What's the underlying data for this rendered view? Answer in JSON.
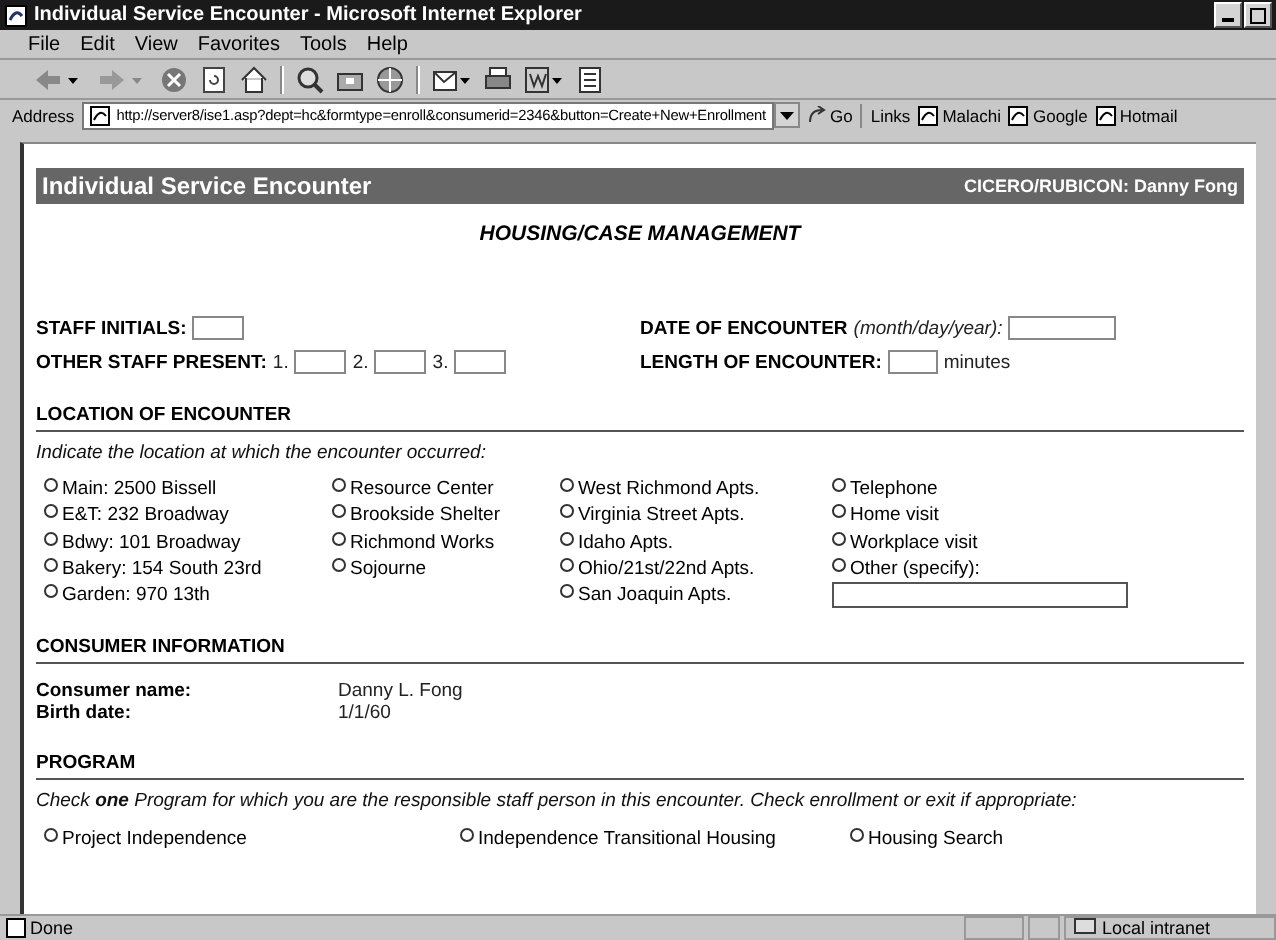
{
  "window": {
    "title": "Individual Service Encounter - Microsoft Internet Explorer"
  },
  "menu": [
    "File",
    "Edit",
    "View",
    "Favorites",
    "Tools",
    "Help"
  ],
  "address": {
    "label": "Address",
    "value": "http://server8/ise1.asp?dept=hc&formtype=enroll&consumerid=2346&button=Create+New+Enrollment",
    "go": "Go",
    "links_label": "Links",
    "links": [
      "Malachi",
      "Google",
      "Hotmail"
    ]
  },
  "page": {
    "header_title": "Individual Service Encounter",
    "header_user": "CICERO/RUBICON: Danny Fong",
    "subtitle": "HOUSING/CASE MANAGEMENT"
  },
  "staff": {
    "initials_label": "STAFF INITIALS:",
    "other_label": "OTHER STAFF PRESENT:",
    "other_numbers": [
      "1.",
      "2.",
      "3."
    ],
    "date_label": "DATE OF ENCOUNTER",
    "date_hint": "(month/day/year):",
    "length_label": "LENGTH OF ENCOUNTER:",
    "length_unit": "minutes"
  },
  "location": {
    "heading": "LOCATION OF ENCOUNTER",
    "instruction": "Indicate the location at which the encounter occurred:",
    "columns": [
      [
        {
          "label": "Main: 2500 Bissell",
          "selected": false
        },
        {
          "label": "E&T: 232 Broadway",
          "selected": false
        },
        {
          "label": "Bdwy: 101 Broadway",
          "selected": false
        },
        {
          "label": "Bakery: 154 South 23rd",
          "selected": false
        },
        {
          "label": "Garden: 970 13th",
          "selected": false
        }
      ],
      [
        {
          "label": "Resource Center",
          "selected": false
        },
        {
          "label": "Brookside Shelter",
          "selected": false
        },
        {
          "label": "Richmond Works",
          "selected": false
        },
        {
          "label": "Sojourne",
          "selected": false
        }
      ],
      [
        {
          "label": "West Richmond Apts.",
          "selected": false
        },
        {
          "label": "Virginia Street Apts.",
          "selected": false
        },
        {
          "label": "Idaho Apts.",
          "selected": false
        },
        {
          "label": "Ohio/21st/22nd Apts.",
          "selected": false
        },
        {
          "label": "San Joaquin Apts.",
          "selected": false
        }
      ],
      [
        {
          "label": "Telephone",
          "selected": false
        },
        {
          "label": "Home visit",
          "selected": false
        },
        {
          "label": "Workplace visit",
          "selected": false
        },
        {
          "label": "Other (specify):",
          "selected": false
        }
      ]
    ]
  },
  "consumer": {
    "heading": "CONSUMER INFORMATION",
    "fields": [
      {
        "label": "Consumer name:",
        "value": "Danny L. Fong"
      },
      {
        "label": "Birth date:",
        "value": "1/1/60"
      }
    ]
  },
  "program": {
    "heading": "PROGRAM",
    "instruction": "Check **one** Program for which you are the responsible staff person in this encounter. Check enrollment or exit if appropriate:",
    "options": [
      {
        "label": "Project Independence",
        "selected": false
      },
      {
        "label": "Independence Transitional Housing",
        "selected": false
      },
      {
        "label": "Housing Search",
        "selected": false
      }
    ]
  },
  "status_bar": {
    "text": "Done",
    "zone": "Local intranet"
  }
}
